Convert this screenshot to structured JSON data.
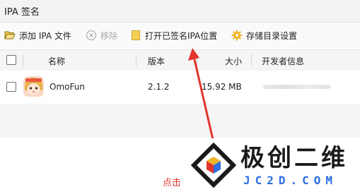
{
  "window": {
    "title": "IPA 签名"
  },
  "toolbar": {
    "add_label": "添加 IPA 文件",
    "remove_label": "移除",
    "open_label": "打开已签名IPA位置",
    "settings_label": "存储目录设置"
  },
  "table": {
    "columns": [
      "名称",
      "版本",
      "大小",
      "开发者信息"
    ],
    "rows": [
      {
        "name": "OmoFun",
        "version": "2.1.2",
        "size": "15.92 MB"
      }
    ]
  },
  "annotation": {
    "hint": "点击"
  },
  "watermark": {
    "brand": "极创二维",
    "domain": "JC2D.COM"
  },
  "colors": {
    "arrow": "#e2352d",
    "folder": "#f6cf56",
    "gear": "#f0b429",
    "domain": "#2c6de0"
  }
}
